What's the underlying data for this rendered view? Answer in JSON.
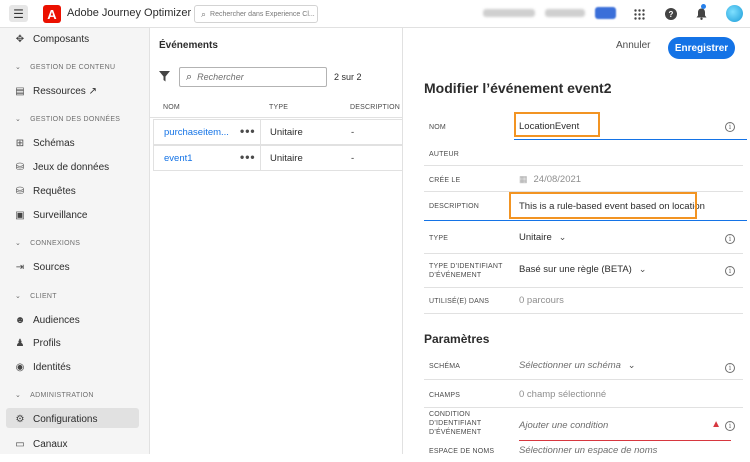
{
  "topbar": {
    "app_name": "Adobe Journey Optimizer",
    "search_placeholder": "Rechercher dans Experience Cl...",
    "logo_letter": "A",
    "accent": "#eb1000"
  },
  "sidebar": {
    "items": [
      {
        "label": "Composants",
        "icon": "components-icon"
      },
      {
        "section": "GESTION DE CONTENU"
      },
      {
        "label": "Ressources ↗",
        "icon": "assets-icon"
      },
      {
        "section": "GESTION DES DONNÉES"
      },
      {
        "label": "Schémas",
        "icon": "schema-icon"
      },
      {
        "label": "Jeux de données",
        "icon": "dataset-icon"
      },
      {
        "label": "Requêtes",
        "icon": "query-icon"
      },
      {
        "label": "Surveillance",
        "icon": "monitoring-icon"
      },
      {
        "section": "CONNEXIONS"
      },
      {
        "label": "Sources",
        "icon": "sources-icon"
      },
      {
        "section": "CLIENT"
      },
      {
        "label": "Audiences",
        "icon": "audiences-icon"
      },
      {
        "label": "Profils",
        "icon": "profiles-icon"
      },
      {
        "label": "Identités",
        "icon": "identities-icon"
      },
      {
        "section": "ADMINISTRATION"
      },
      {
        "label": "Configurations",
        "icon": "configurations-icon",
        "active": true
      },
      {
        "label": "Canaux",
        "icon": "channels-icon"
      }
    ]
  },
  "events_list": {
    "title": "Événements",
    "search_placeholder": "Rechercher",
    "count": "2 sur 2",
    "columns": [
      "NOM",
      "TYPE",
      "DESCRIPTION"
    ],
    "rows": [
      {
        "name": "purchaseitem...",
        "type": "Unitaire",
        "description": "-"
      },
      {
        "name": "event1",
        "type": "Unitaire",
        "description": "-"
      }
    ]
  },
  "panel": {
    "cancel_label": "Annuler",
    "save_label": "Enregistrer",
    "title": "Modifier l’événement event2",
    "fields": {
      "nom": {
        "label": "NOM",
        "value": "LocationEvent"
      },
      "auteur": {
        "label": "AUTEUR",
        "value": ""
      },
      "cree_le": {
        "label": "CRÉE LE",
        "value": "24/08/2021"
      },
      "description": {
        "label": "DESCRIPTION",
        "value": "This is a rule-based event based on location"
      },
      "type": {
        "label": "TYPE",
        "value": "Unitaire"
      },
      "type_id_1": {
        "label": "TYPE D’IDENTIFIANT",
        "label2": "D’ÉVÉNEMENT",
        "value": "Basé sur une règle (BETA)"
      },
      "utilise": {
        "label": "UTILISÉ(E) DANS",
        "value": "0 parcours"
      }
    },
    "parametres_title": "Paramètres",
    "params": {
      "schema": {
        "label": "SCHÉMA",
        "value": "Sélectionner un schéma"
      },
      "champs": {
        "label": "CHAMPS",
        "value": "0 champ sélectionné"
      },
      "condition": {
        "label": "CONDITION",
        "label2": "D’IDENTIFIANT",
        "label3": "D’ÉVÉNEMENT",
        "value": "Ajouter une condition"
      },
      "espace": {
        "label": "ESPACE DE NOMS",
        "value": "Sélectionner un espace de noms"
      }
    },
    "highlight_color": "#f29423"
  }
}
